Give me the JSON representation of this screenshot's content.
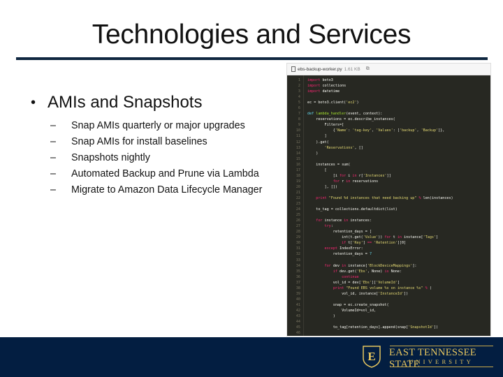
{
  "slide": {
    "title": "Technologies and Services",
    "bullet": "AMIs and Snapshots",
    "bullet_marker": "•",
    "sub_marker": "–",
    "sub_items": [
      "Snap AMIs quarterly or major upgrades",
      "Snap AMIs for install baselines",
      "Snapshots nightly",
      "Automated Backup and Prune via Lambda",
      "Migrate to Amazon Data Lifecycle Manager"
    ]
  },
  "code": {
    "filename": "ebs-backup-worker.py",
    "filesize": "1.61 KB",
    "copy_icon": "⧉",
    "line_count": 46
  },
  "footer": {
    "logo_letter": "E",
    "org_line1": "EAST TENNESSEE STATE",
    "org_line2": "UNIVERSITY",
    "colors": {
      "navy": "#031e41",
      "gold": "#e8c75f"
    }
  }
}
